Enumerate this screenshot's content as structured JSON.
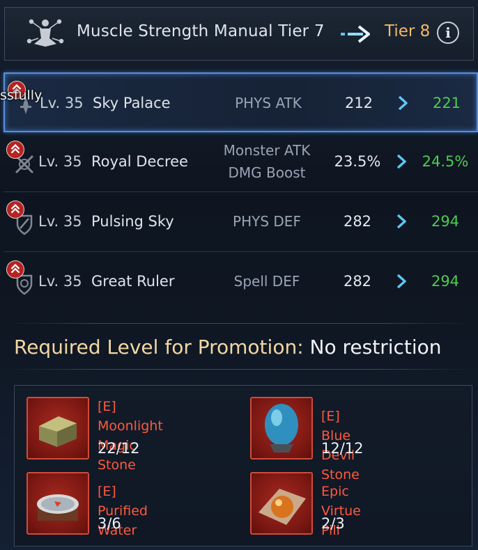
{
  "header": {
    "title": "Muscle Strength Manual Tier 7",
    "next_tier": "Tier 8",
    "info_icon": "info-icon",
    "info_glyph": "i",
    "header_icon": "meditation-icon",
    "arrow_icon": "arrow-right-icon"
  },
  "toast_fragment": "ssfully",
  "stats": [
    {
      "level": "Lv. 35",
      "name": "Sky Palace",
      "attr_line1": "PHYS ATK",
      "attr_line2": "",
      "current": "212",
      "next": "221",
      "icon": "weapon-icon",
      "selected": true
    },
    {
      "level": "Lv. 35",
      "name": "Royal Decree",
      "attr_line1": "Monster ATK",
      "attr_line2": "DMG Boost",
      "current": "23.5%",
      "next": "24.5%",
      "icon": "crossed-swords-icon",
      "selected": false
    },
    {
      "level": "Lv. 35",
      "name": "Pulsing Sky",
      "attr_line1": "PHYS DEF",
      "attr_line2": "",
      "current": "282",
      "next": "294",
      "icon": "shield-sword-icon",
      "selected": false
    },
    {
      "level": "Lv. 35",
      "name": "Great Ruler",
      "attr_line1": "Spell DEF",
      "attr_line2": "",
      "current": "282",
      "next": "294",
      "icon": "shield-magic-icon",
      "selected": false
    }
  ],
  "promotion": {
    "label": "Required Level for Promotion:",
    "value": "No restriction"
  },
  "materials": [
    {
      "name_line1": "[E] Moonlight Magic",
      "name_line2": "Stone",
      "count": "22/12",
      "icon": "stone-block-icon"
    },
    {
      "name_line1": "[E] Blue Devil Stone",
      "name_line2": "",
      "count": "12/12",
      "icon": "blue-egg-icon"
    },
    {
      "name_line1": "[E] Purified Water",
      "name_line2": "",
      "count": "3/6",
      "icon": "water-bowl-icon"
    },
    {
      "name_line1": "Epic Virtue Pill",
      "name_line2": "",
      "count": "2/3",
      "icon": "pill-icon"
    }
  ],
  "colors": {
    "accent_tier": "#f2b866",
    "next_value": "#4ecb52",
    "material_name": "#ff5a3d",
    "required_label": "#f2d7a4"
  }
}
